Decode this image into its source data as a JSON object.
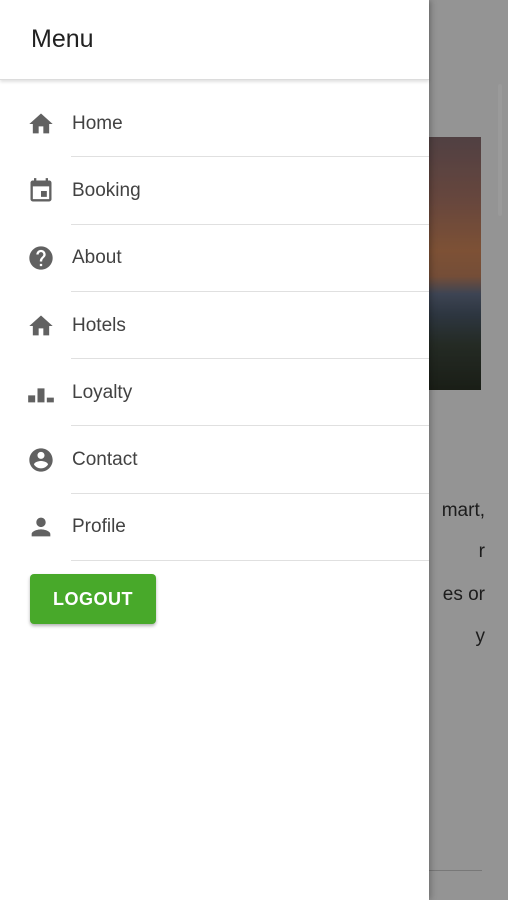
{
  "drawer": {
    "title": "Menu",
    "items": [
      {
        "label": "Home",
        "icon": "home-icon"
      },
      {
        "label": "Booking",
        "icon": "calendar-icon"
      },
      {
        "label": "About",
        "icon": "help-circle-icon"
      },
      {
        "label": "Hotels",
        "icon": "home-icon"
      },
      {
        "label": "Loyalty",
        "icon": "bar-chart-icon"
      },
      {
        "label": "Contact",
        "icon": "account-circle-icon"
      },
      {
        "label": "Profile",
        "icon": "person-icon"
      }
    ],
    "logout_label": "LOGOUT"
  },
  "background": {
    "text_lines": [
      "mart,",
      "r",
      "es or",
      "y"
    ]
  },
  "colors": {
    "accent": "#48a92a",
    "icon": "#616161",
    "scrim": "rgba(0,0,0,0.42)"
  }
}
